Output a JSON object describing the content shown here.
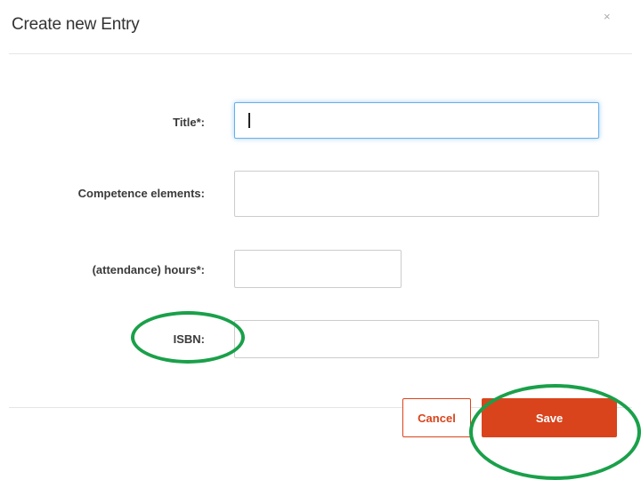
{
  "dialog": {
    "title": "Create new Entry",
    "close_label": "×"
  },
  "form": {
    "title_label": "Title*:",
    "title_value": "",
    "competence_label": "Competence elements:",
    "competence_value": "",
    "hours_label": "(attendance) hours*:",
    "hours_value": "",
    "isbn_label": "ISBN:",
    "isbn_value": ""
  },
  "footer": {
    "cancel_label": "Cancel",
    "save_label": "Save"
  },
  "colors": {
    "accent": "#d9441c",
    "annotation": "#1aa04a",
    "focus": "#66afe9"
  }
}
